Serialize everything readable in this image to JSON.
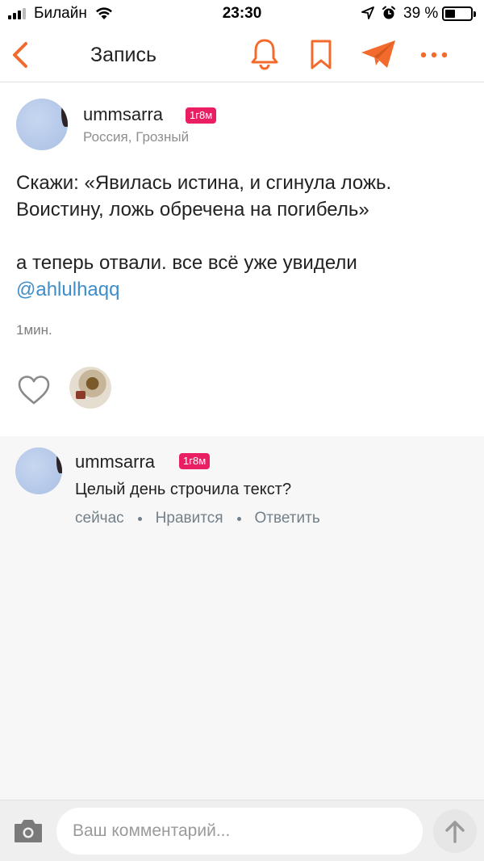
{
  "status_bar": {
    "carrier": "Билайн",
    "time": "23:30",
    "battery_percent": "39 %",
    "battery_level": 0.39,
    "icons": [
      "signal-icon",
      "wifi-icon",
      "location-arrow-icon",
      "alarm-icon",
      "battery-icon"
    ]
  },
  "nav": {
    "title": "Запись",
    "icons": [
      "back-chevron-icon",
      "bell-icon",
      "bookmark-icon",
      "send-icon",
      "more-icon"
    ],
    "accent_color": "#f26b2c"
  },
  "post": {
    "username": "ummsarra",
    "badge": "1г8м",
    "location": "Россия, Грозный",
    "text_line1": "Скажи: «Явилась истина, и сгинула ложь.",
    "text_line2": "Воистину, ложь обречена на погибель»",
    "text_line3": "а теперь отвали. все всё уже увидели",
    "mention": "@ahlulhaqq",
    "time": "1мин.",
    "badge_color": "#e91e63",
    "mention_color": "#3d8ec9"
  },
  "comment": {
    "username": "ummsarra",
    "badge": "1г8м",
    "text": "Целый день строчила текст?",
    "time": "сейчас",
    "like_label": "Нравится",
    "reply_label": "Ответить"
  },
  "input": {
    "placeholder": "Ваш комментарий..."
  }
}
